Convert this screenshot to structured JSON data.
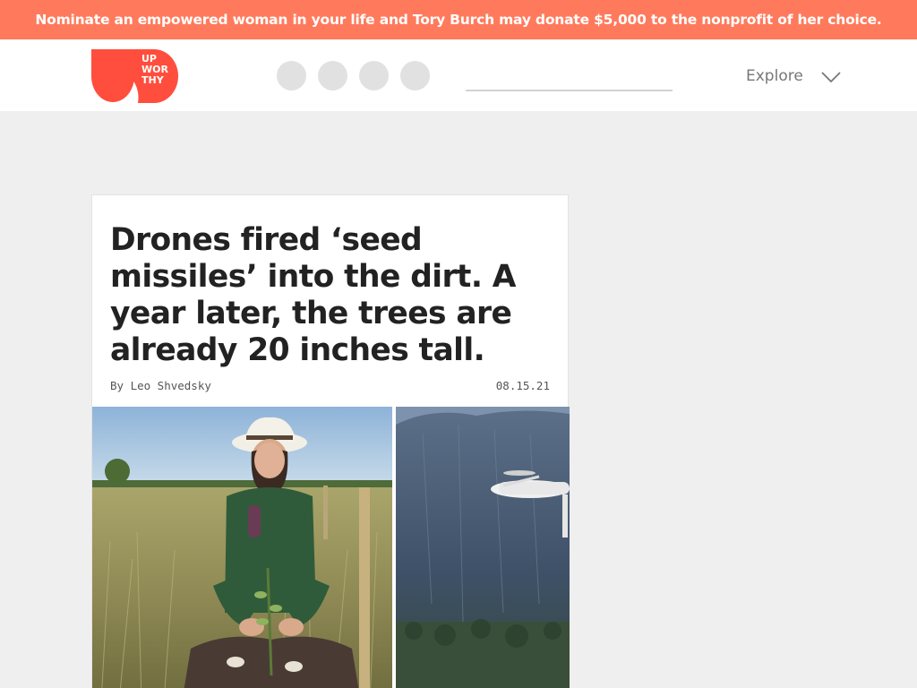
{
  "promo_banner": {
    "text": "Nominate an empowered woman in your life and Tory Burch may donate $5,000 to the nonprofit of her choice.",
    "background_color": "#ff7a5c"
  },
  "header": {
    "logo": {
      "text_lines": [
        "UP",
        "WOR",
        "THY"
      ],
      "brand_color": "#ff4e3d"
    },
    "social_icons": [
      "facebook-icon",
      "twitter-icon",
      "instagram-icon",
      "youtube-icon"
    ],
    "search": {
      "value": "",
      "placeholder": ""
    },
    "explore": {
      "label": "Explore"
    }
  },
  "article": {
    "title": "Drones fired ‘seed missiles’ into the dirt. A year later, the trees are already 20 inches tall.",
    "byline": "By Leo Shvedsky",
    "date": "08.15.21",
    "images": [
      {
        "name": "woman-planting-seedling-photo"
      },
      {
        "name": "drone-over-cliffs-photo"
      }
    ]
  }
}
